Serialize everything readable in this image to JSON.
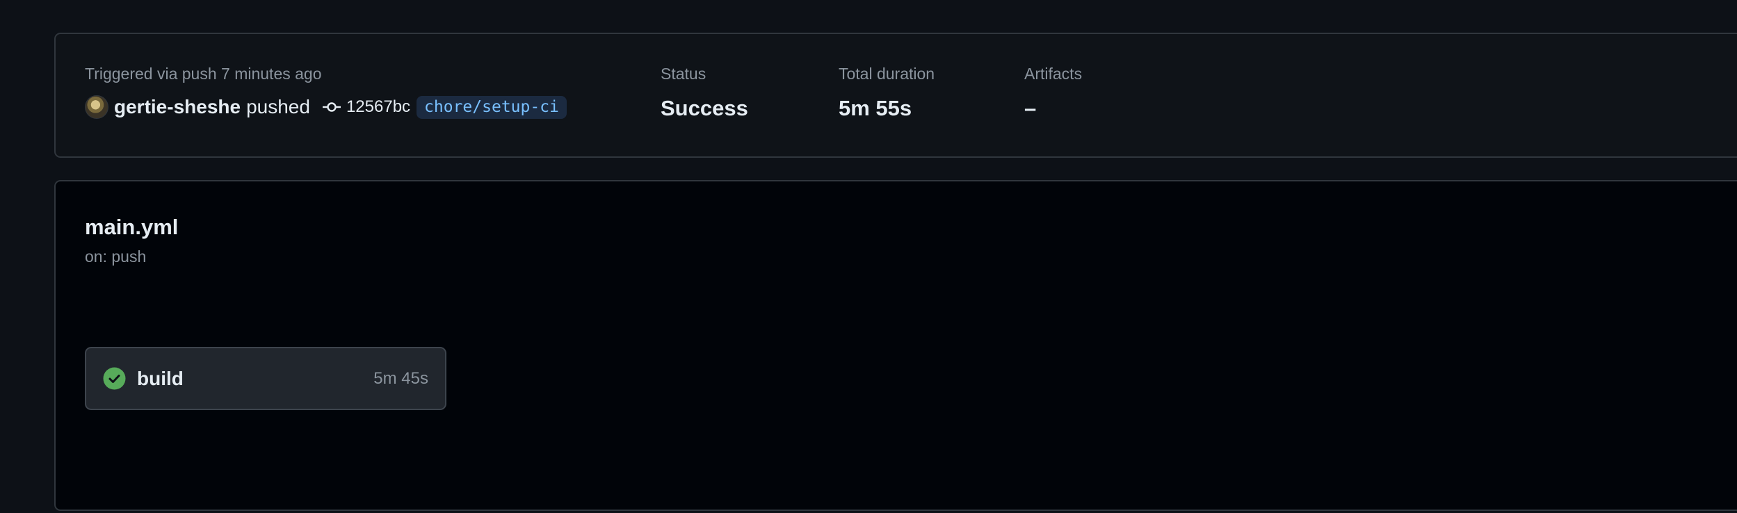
{
  "summary": {
    "trigger_label": "Triggered via push 7 minutes ago",
    "actor": "gertie-sheshe",
    "action": "pushed",
    "commit_sha": "12567bc",
    "branch": "chore/setup-ci",
    "status_label": "Status",
    "status_value": "Success",
    "duration_label": "Total duration",
    "duration_value": "5m 55s",
    "artifacts_label": "Artifacts",
    "artifacts_value": "–"
  },
  "workflow": {
    "file_name": "main.yml",
    "trigger": "on: push",
    "jobs": [
      {
        "name": "build",
        "duration": "5m 45s",
        "status": "success",
        "icon": "check-circle-icon"
      }
    ]
  },
  "colors": {
    "success": "#57ab5a",
    "branch_text": "#79c0ff",
    "branch_bg": "#1b2a40",
    "muted_text": "#8b949e",
    "page_bg": "#0d1117"
  }
}
